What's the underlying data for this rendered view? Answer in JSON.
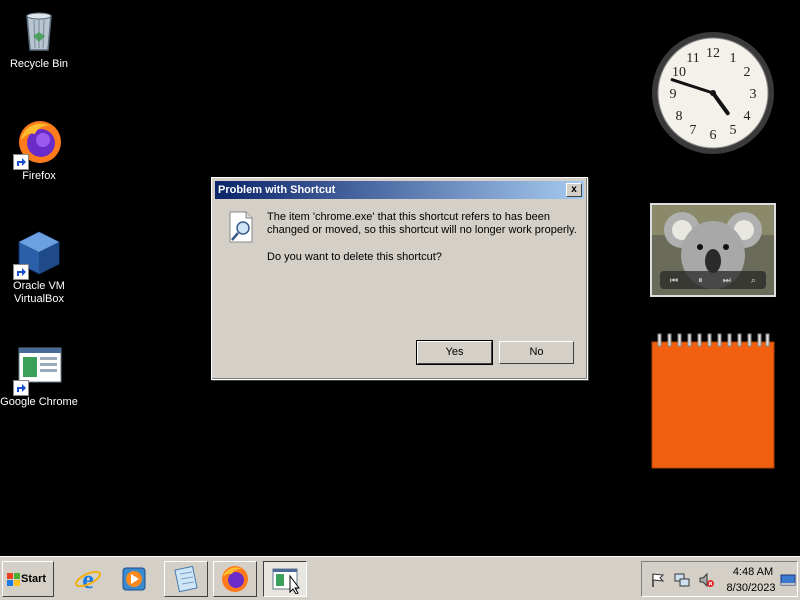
{
  "desktop": {
    "icons": [
      {
        "label": "Recycle Bin"
      },
      {
        "label": "Firefox"
      },
      {
        "label": "Oracle VM\nVirtualBox"
      },
      {
        "label": "Google Chrome"
      }
    ]
  },
  "gadgets": {
    "clock": {
      "hour": 4,
      "minute": 48
    },
    "slideshow": {
      "controls": [
        "prev",
        "pause",
        "next",
        "view"
      ]
    },
    "notes": {
      "color": "#f06010"
    }
  },
  "dialog": {
    "title": "Problem with Shortcut",
    "close_label": "x",
    "message": "The item 'chrome.exe' that this shortcut refers to has been changed or moved, so this shortcut will no longer work properly.",
    "question": "Do you want to delete this shortcut?",
    "yes_label": "Yes",
    "no_label": "No"
  },
  "taskbar": {
    "start_label": "Start",
    "pinned": [
      "internet-explorer",
      "media-player",
      "notepad",
      "firefox",
      "chrome"
    ],
    "tray": {
      "time": "4:48 AM",
      "date": "8/30/2023"
    }
  },
  "colors": {
    "titlebar_start": "#0a246a",
    "titlebar_end": "#a6caf0",
    "dialog_bg": "#d4d0c8"
  }
}
